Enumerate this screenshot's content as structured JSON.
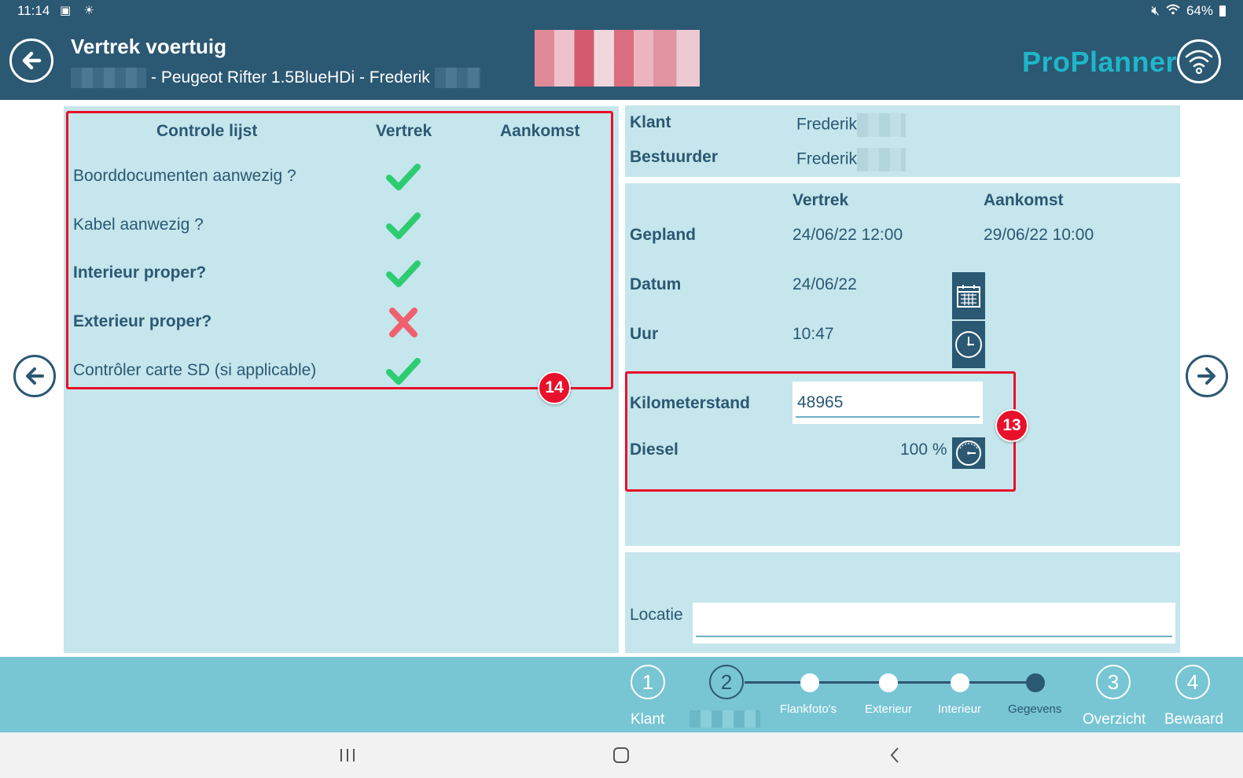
{
  "status_bar": {
    "time": "11:14",
    "battery": "64%"
  },
  "header": {
    "title": "Vertrek voertuig",
    "subtitle": "- Peugeot Rifter 1.5BlueHDi - Frederik",
    "brand": "ProPlanner"
  },
  "checklist": {
    "col_item": "Controle lijst",
    "col_depart": "Vertrek",
    "col_arrive": "Aankomst",
    "items": [
      {
        "label": "Boorddocumenten aanwezig ?",
        "status": "check",
        "bold": false
      },
      {
        "label": "Kabel aanwezig ?",
        "status": "check",
        "bold": false
      },
      {
        "label": "Interieur proper?",
        "status": "check",
        "bold": true
      },
      {
        "label": "Exterieur proper?",
        "status": "cross",
        "bold": true
      },
      {
        "label": "Contrôler carte SD (si applicable)",
        "status": "check",
        "bold": false
      }
    ],
    "badge": "14"
  },
  "customer": {
    "klant_label": "Klant",
    "klant_value": "Frederik",
    "bestuurder_label": "Bestuurder",
    "bestuurder_value": "Frederik"
  },
  "schedule": {
    "col_depart": "Vertrek",
    "col_arrive": "Aankomst",
    "gepland_label": "Gepland",
    "gepland_depart": "24/06/22 12:00",
    "gepland_arrive": "29/06/22 10:00",
    "datum_label": "Datum",
    "datum_value": "24/06/22",
    "uur_label": "Uur",
    "uur_value": "10:47"
  },
  "readings": {
    "km_label": "Kilometerstand",
    "km_value": "48965",
    "fuel_label": "Diesel",
    "fuel_value": "100 %",
    "badge": "13"
  },
  "location": {
    "label": "Locatie",
    "value": ""
  },
  "stepper": {
    "steps": [
      {
        "num": "1",
        "label": "Klant"
      },
      {
        "num": "2",
        "label": ""
      },
      {
        "num": "3",
        "label": "Overzicht"
      },
      {
        "num": "4",
        "label": "Bewaard"
      }
    ],
    "substeps": [
      "Flankfoto's",
      "Exterieur",
      "Interieur",
      "Gegevens"
    ]
  },
  "colors": {
    "header": "#2b5873",
    "panel": "#c5e6ec",
    "brand": "#1fb6c9",
    "stepper": "#78c5d4",
    "check": "#2ecc71",
    "cross": "#f0606e",
    "highlight": "#e8102a"
  }
}
